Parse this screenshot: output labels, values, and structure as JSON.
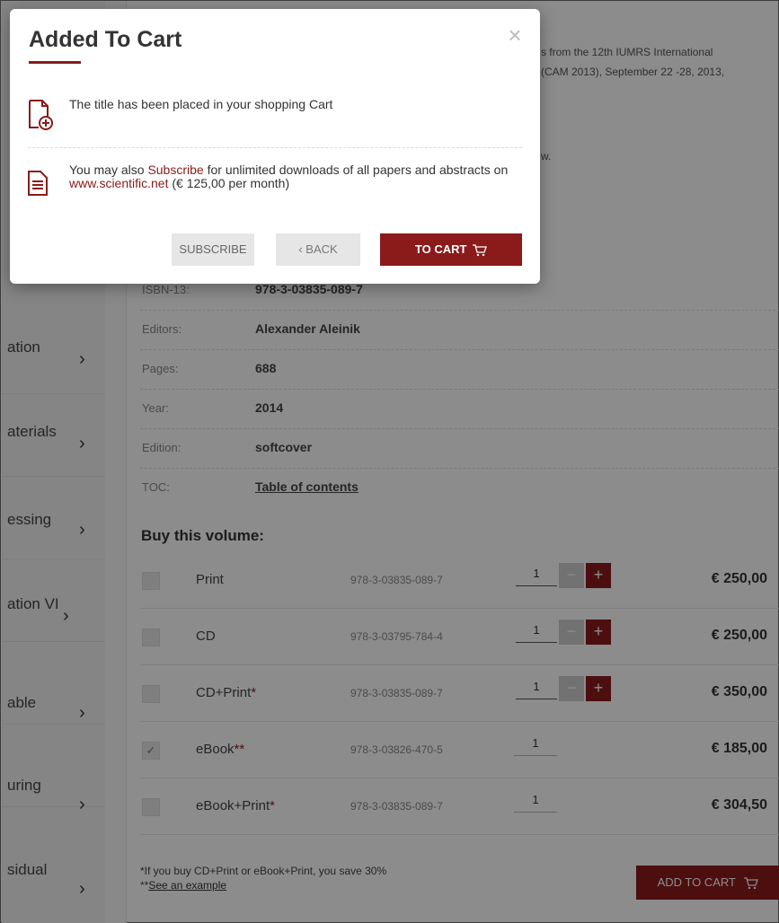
{
  "sidebar": {
    "items": [
      {
        "label": "ation"
      },
      {
        "label": "aterials"
      },
      {
        "label": "essing"
      },
      {
        "label": "ation VI"
      },
      {
        "label": "able"
      },
      {
        "label": "uring"
      },
      {
        "label": "sidual"
      }
    ],
    "chevron": "›"
  },
  "description": {
    "line1": "s from the 12th IUMRS International",
    "line2": "(CAM 2013), September 22 -28, 2013,",
    "line3": "w."
  },
  "info": {
    "isbn_label": "ISBN-13:",
    "isbn_value": "978-3-03835-089-7",
    "editors_label": "Editors:",
    "editors_value": "Alexander Aleinik",
    "pages_label": "Pages:",
    "pages_value": "688",
    "year_label": "Year:",
    "year_value": "2014",
    "edition_label": "Edition:",
    "edition_value": "softcover",
    "toc_label": "TOC:",
    "toc_value": "Table of contents"
  },
  "buy": {
    "title": "Buy this volume:",
    "rows": [
      {
        "name": "Print",
        "stars": "",
        "isbn": "978-3-03835-089-7",
        "qty": "1",
        "price": "€ 250,00",
        "checked": ""
      },
      {
        "name": "CD",
        "stars": "",
        "isbn": "978-3-03795-784-4",
        "qty": "1",
        "price": "€ 250,00",
        "checked": ""
      },
      {
        "name": "CD+Print",
        "stars": "*",
        "isbn": "978-3-03835-089-7",
        "qty": "1",
        "price": "€ 350,00",
        "checked": ""
      },
      {
        "name": "eBook",
        "stars": "**",
        "isbn": "978-3-03826-470-5",
        "qty": "1",
        "price": "€ 185,00",
        "checked": "✓"
      },
      {
        "name": "eBook+Print",
        "stars": "*",
        "isbn": "978-3-03835-089-7",
        "qty": "1",
        "price": "€ 304,50",
        "checked": ""
      }
    ],
    "minus_label": "−",
    "plus_label": "+",
    "note1": "*If you buy CD+Print or eBook+Print, you save 30%",
    "note2_prefix": "**",
    "note2_link": "See an example",
    "add_to_cart": "ADD TO CART"
  },
  "modal": {
    "title": "Added To Cart",
    "close": "×",
    "message1": "The title has been placed in your shopping Cart",
    "message2_a": "You may also ",
    "message2_subscribe": "Subscribe",
    "message2_b": " for unlimited downloads of all papers and abstracts on ",
    "message2_site": "www.scientific.net",
    "message2_c": " (€ 125,00 per month)",
    "subscribe_btn": "SUBSCRIBE",
    "back_btn": "‹  BACK",
    "tocart_btn": "TO CART"
  },
  "colors": {
    "accent": "#8b1a1a",
    "overlay": "rgba(0,0,0,0.45)"
  },
  "icons": {
    "cart": "cart-icon",
    "close": "close-icon",
    "doc_add": "document-add-icon",
    "doc": "document-icon",
    "chevron": "chevron-right-icon"
  }
}
